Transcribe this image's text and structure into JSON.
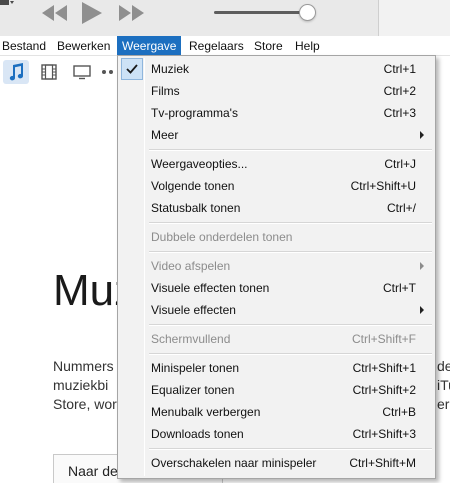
{
  "player": {
    "icons": {
      "back": "previous-track-icon",
      "play": "play-icon",
      "forward": "next-track-icon",
      "volume": "volume-slider"
    },
    "volume_level": 0.9
  },
  "menubar": {
    "items": [
      "Bestand",
      "Bewerken",
      "Weergave",
      "Regelaars",
      "Store",
      "Help"
    ],
    "active": "Weergave",
    "active_color": "#1c6fc0"
  },
  "mediabar": {
    "items": [
      "music-note-icon",
      "film-icon",
      "tv-icon",
      "more-icon"
    ],
    "selected": "music-note-icon"
  },
  "background": {
    "title": "Muz",
    "text_lines": [
      "Nummers",
      "muziekbi",
      "Store, wor"
    ],
    "text_right": [
      "de",
      "iTu",
      "er"
    ],
    "button": "Naar de"
  },
  "menu": {
    "items": [
      {
        "label": "Muziek",
        "shortcut": "Ctrl+1",
        "checked": true
      },
      {
        "label": "Films",
        "shortcut": "Ctrl+2"
      },
      {
        "label": "Tv-programma's",
        "shortcut": "Ctrl+3"
      },
      {
        "label": "Meer",
        "submenu": true
      },
      {
        "label": "Weergaveopties...",
        "shortcut": "Ctrl+J"
      },
      {
        "label": "Volgende tonen",
        "shortcut": "Ctrl+Shift+U"
      },
      {
        "label": "Statusbalk tonen",
        "shortcut": "Ctrl+/"
      },
      {
        "label": "Dubbele onderdelen tonen",
        "disabled": true
      },
      {
        "label": "Video afspelen",
        "submenu": true,
        "disabled": true
      },
      {
        "label": "Visuele effecten tonen",
        "shortcut": "Ctrl+T"
      },
      {
        "label": "Visuele effecten",
        "submenu": true
      },
      {
        "label": "Schermvullend",
        "shortcut": "Ctrl+Shift+F",
        "disabled": true
      },
      {
        "label": "Minispeler tonen",
        "shortcut": "Ctrl+Shift+1"
      },
      {
        "label": "Equalizer tonen",
        "shortcut": "Ctrl+Shift+2"
      },
      {
        "label": "Menubalk verbergen",
        "shortcut": "Ctrl+B"
      },
      {
        "label": "Downloads tonen",
        "shortcut": "Ctrl+Shift+3"
      },
      {
        "label": "Overschakelen naar minispeler",
        "shortcut": "Ctrl+Shift+M"
      }
    ]
  }
}
